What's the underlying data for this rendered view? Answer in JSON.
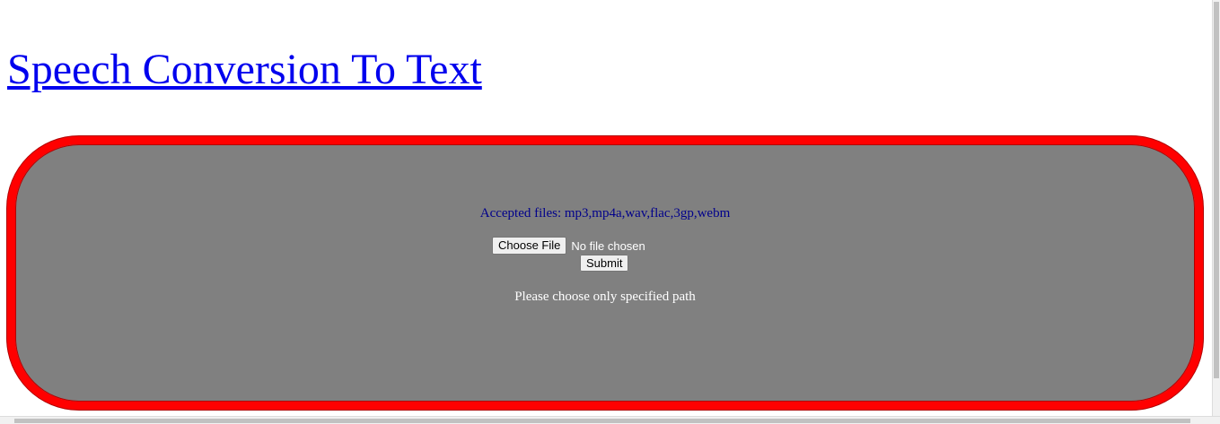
{
  "header": {
    "title_link": "Speech Conversion To Text"
  },
  "upload_panel": {
    "accepted_files": "Accepted files: mp3,mp4a,wav,flac,3gp,webm",
    "choose_file_label": "Choose File",
    "file_status": "No file chosen",
    "submit_label": "Submit",
    "note": "Please choose only specified path"
  },
  "colors": {
    "link": "#0000ee",
    "panel_background": "#808080",
    "panel_border": "#ff0000",
    "accepted_text": "#00008b",
    "note_text": "#ffffff"
  }
}
